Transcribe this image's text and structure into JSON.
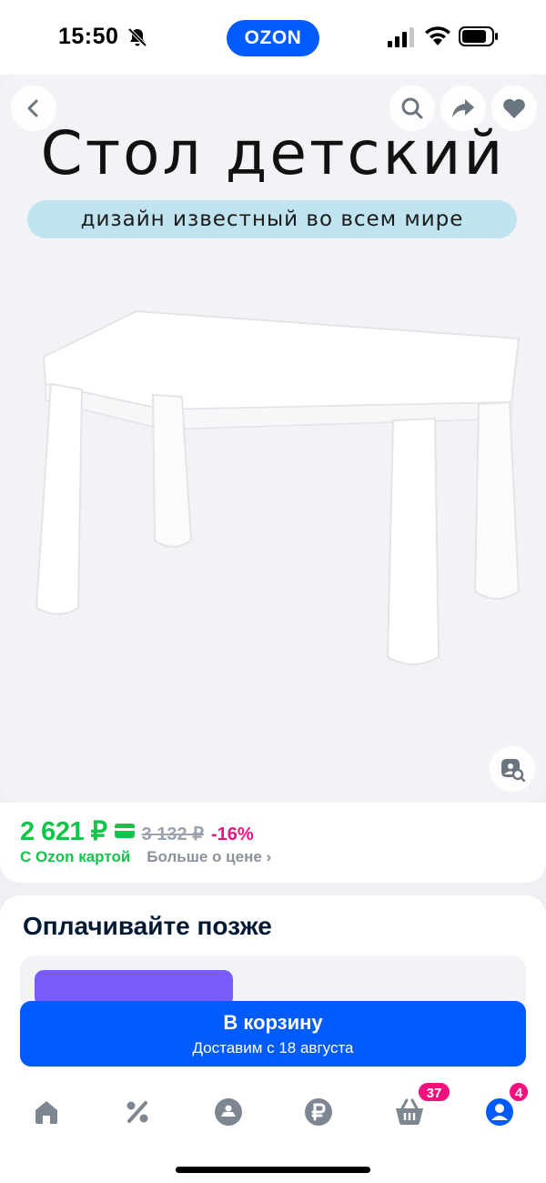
{
  "status_bar": {
    "time": "15:50",
    "brand": "OZON"
  },
  "gallery": {
    "hero_title": "Стол детский",
    "hero_tagline": "дизайн известный во всем мире",
    "icons": [
      "back-icon",
      "search-icon",
      "share-icon",
      "heart-icon",
      "visual-search-icon"
    ]
  },
  "price": {
    "current": "2 621 ₽",
    "old": "3 132 ₽",
    "discount": "-16%",
    "card_label": "С Ozon картой",
    "more_link": "Больше о цене ›"
  },
  "pay_later": {
    "title": "Оплачивайте позже"
  },
  "cart_button": {
    "label": "В корзину",
    "sublabel": "Доставим с 18 августа"
  },
  "bottom_nav": {
    "cart_badge": "37",
    "profile_badge": "4",
    "items": [
      "home-icon",
      "percent-icon",
      "brand-icon",
      "ruble-icon",
      "basket-icon",
      "profile-icon"
    ]
  },
  "colors": {
    "accent": "#005bff",
    "price_green": "#10c44c",
    "discount_pink": "#f1117e",
    "pay_later_chip": "#7a5af8"
  }
}
